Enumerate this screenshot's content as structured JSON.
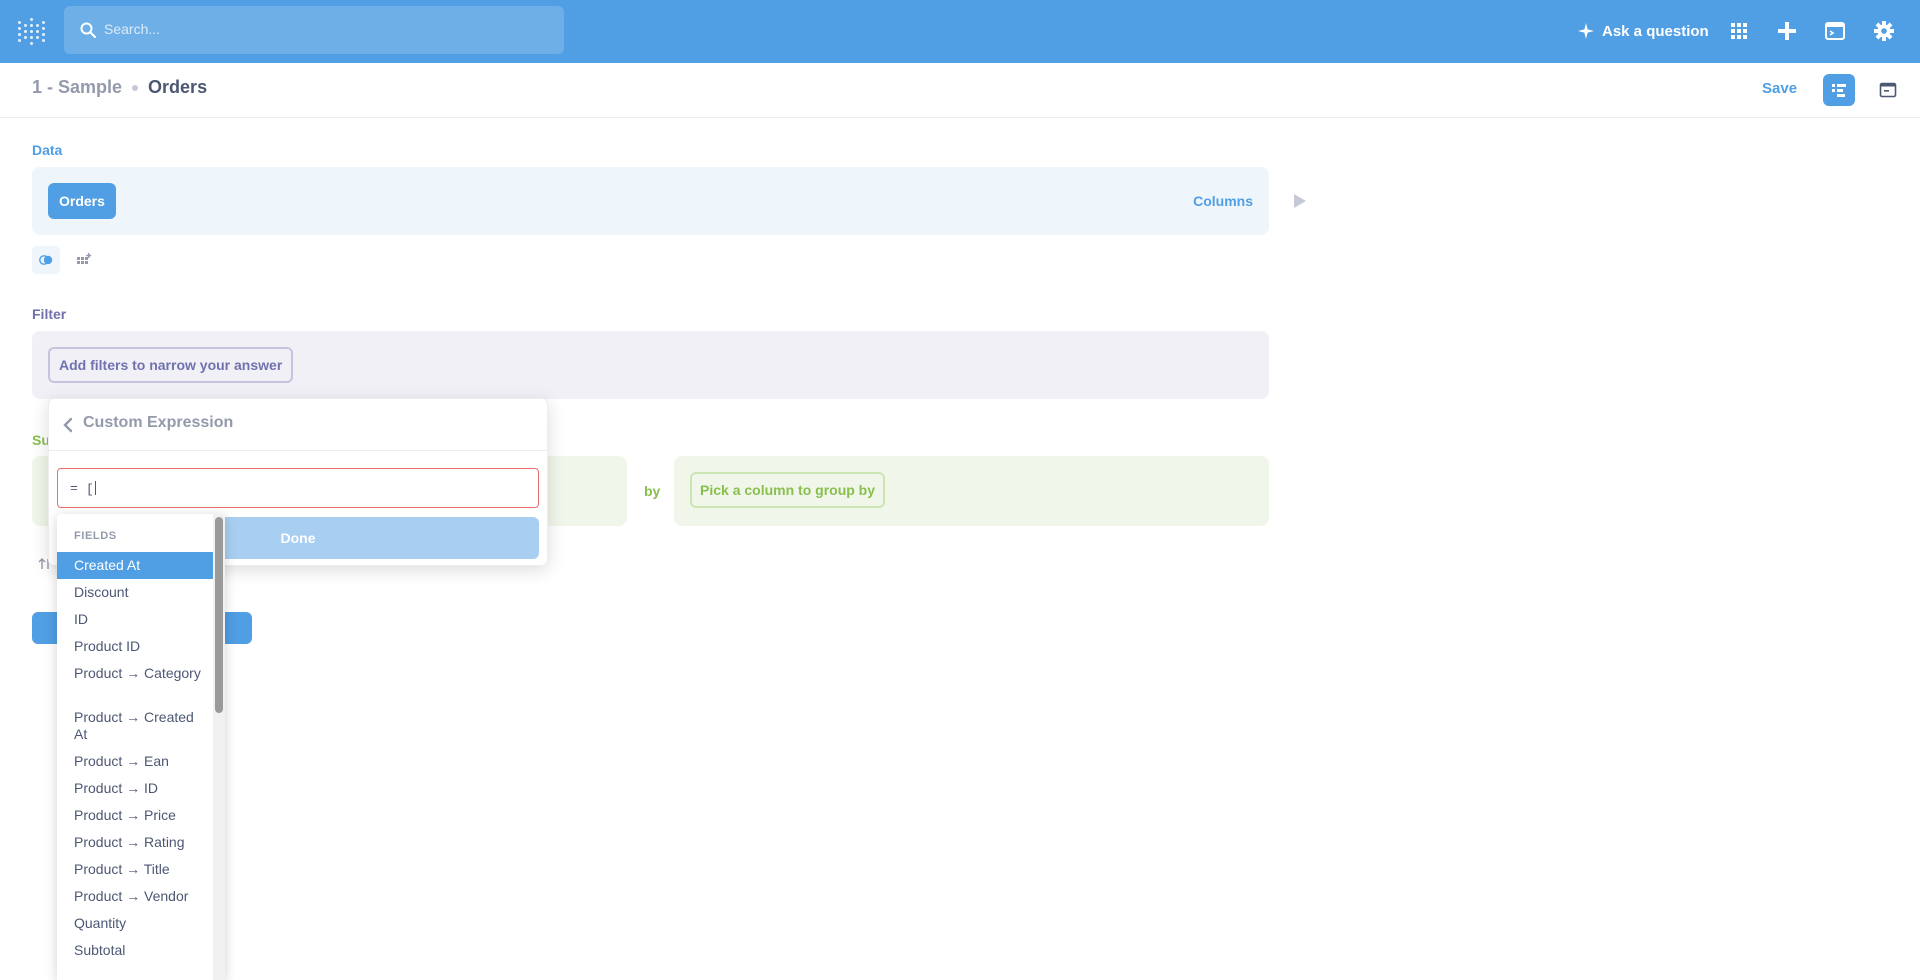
{
  "topnav": {
    "search_placeholder": "Search...",
    "ask_label": "Ask a question",
    "icons": [
      "grid-icon",
      "plus-icon",
      "terminal-icon",
      "gear-icon"
    ]
  },
  "header": {
    "database": "1 - Sample",
    "table": "Orders",
    "save_label": "Save"
  },
  "notebook": {
    "data_label": "Data",
    "data_table": "Orders",
    "columns_label": "Columns",
    "filter_label": "Filter",
    "filter_placeholder": "Add filters to narrow your answer",
    "summarize_label_visible": "Su",
    "by_label": "by",
    "group_placeholder": "Pick a column to group by"
  },
  "popover": {
    "title": "Custom Expression",
    "equals": "=",
    "expression_value": "[",
    "done_label": "Done"
  },
  "suggestions": {
    "heading": "FIELDS",
    "selected_index": 0,
    "items": [
      "Created At",
      "Discount",
      "ID",
      "Product ID",
      "Product → Category",
      "Product → Created At",
      "Product → Ean",
      "Product → ID",
      "Product → Price",
      "Product → Rating",
      "Product → Title",
      "Product → Vendor",
      "Quantity",
      "Subtotal"
    ]
  },
  "colors": {
    "brand": "#509ee3",
    "filter": "#7172ad",
    "summarize": "#88bf4d",
    "error": "#ed6e6e"
  }
}
